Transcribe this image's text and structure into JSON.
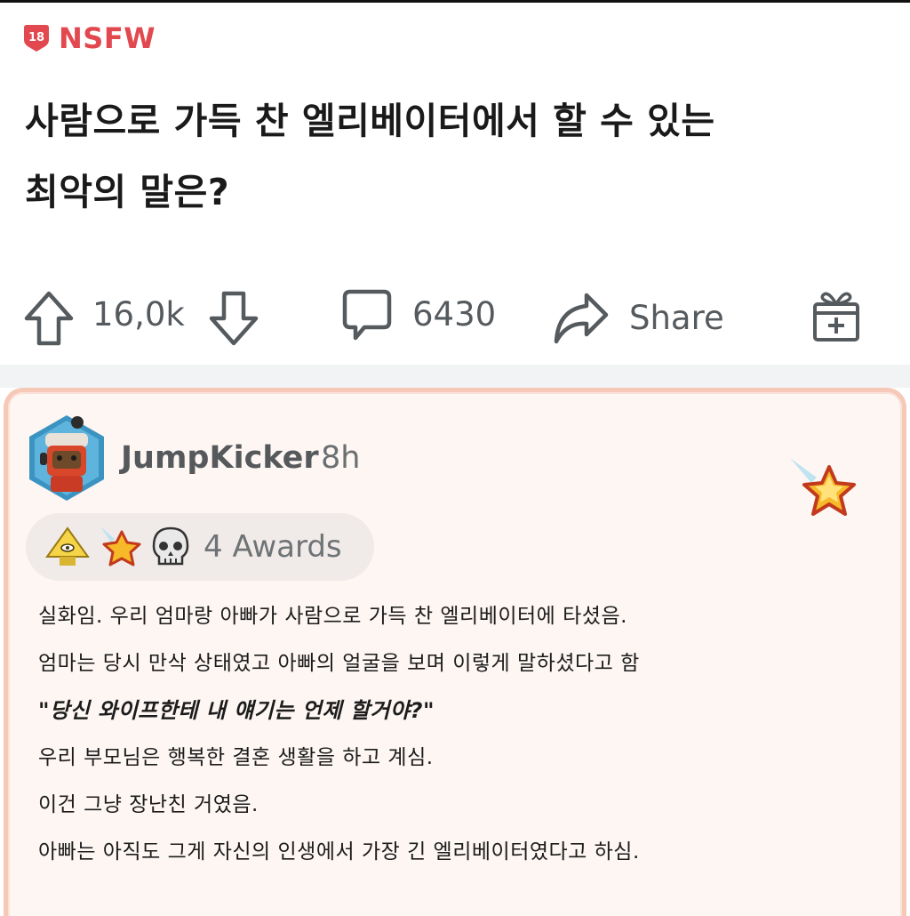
{
  "post": {
    "nsfw_label": "NSFW",
    "nsfw_badge_number": "18",
    "title_line1": "사람으로 가득 찬 엘리베이터에서 할 수 있는",
    "title_line2": "최악의 말은?"
  },
  "actions": {
    "score": "16,0k",
    "comment_count": "6430",
    "share_label": "Share",
    "icons": [
      "upvote-icon",
      "downvote-icon",
      "comment-icon",
      "share-icon",
      "gift-icon"
    ]
  },
  "comment": {
    "username": "JumpKicker",
    "timestamp": "8h",
    "awards_label": "4 Awards",
    "award_icons": [
      "pyramid-award-icon",
      "star-award-icon",
      "skull-award-icon"
    ],
    "featured_award_icon": "falling-star-icon",
    "body": [
      "실화임. 우리 엄마랑 아빠가 사람으로 가득 찬 엘리베이터에 타셨음.",
      "엄마는 당시 만삭 상태였고 아빠의 얼굴을 보며 이렇게 말하셨다고 함",
      "\"당신 와이프한테 내 얘기는 언제 할거야?\"",
      "우리 부모님은 행복한 결혼 생활을 하고 계심.",
      "이건 그냥 장난친 거였음.",
      "아빠는 아직도 그게 자신의 인생에서 가장 긴 엘리베이터였다고 하심."
    ]
  },
  "colors": {
    "nsfw_red": "#e2484f",
    "card_background": "#fdf6f3",
    "card_border": "#f6c8b8",
    "icon_gray": "#555a5e"
  }
}
